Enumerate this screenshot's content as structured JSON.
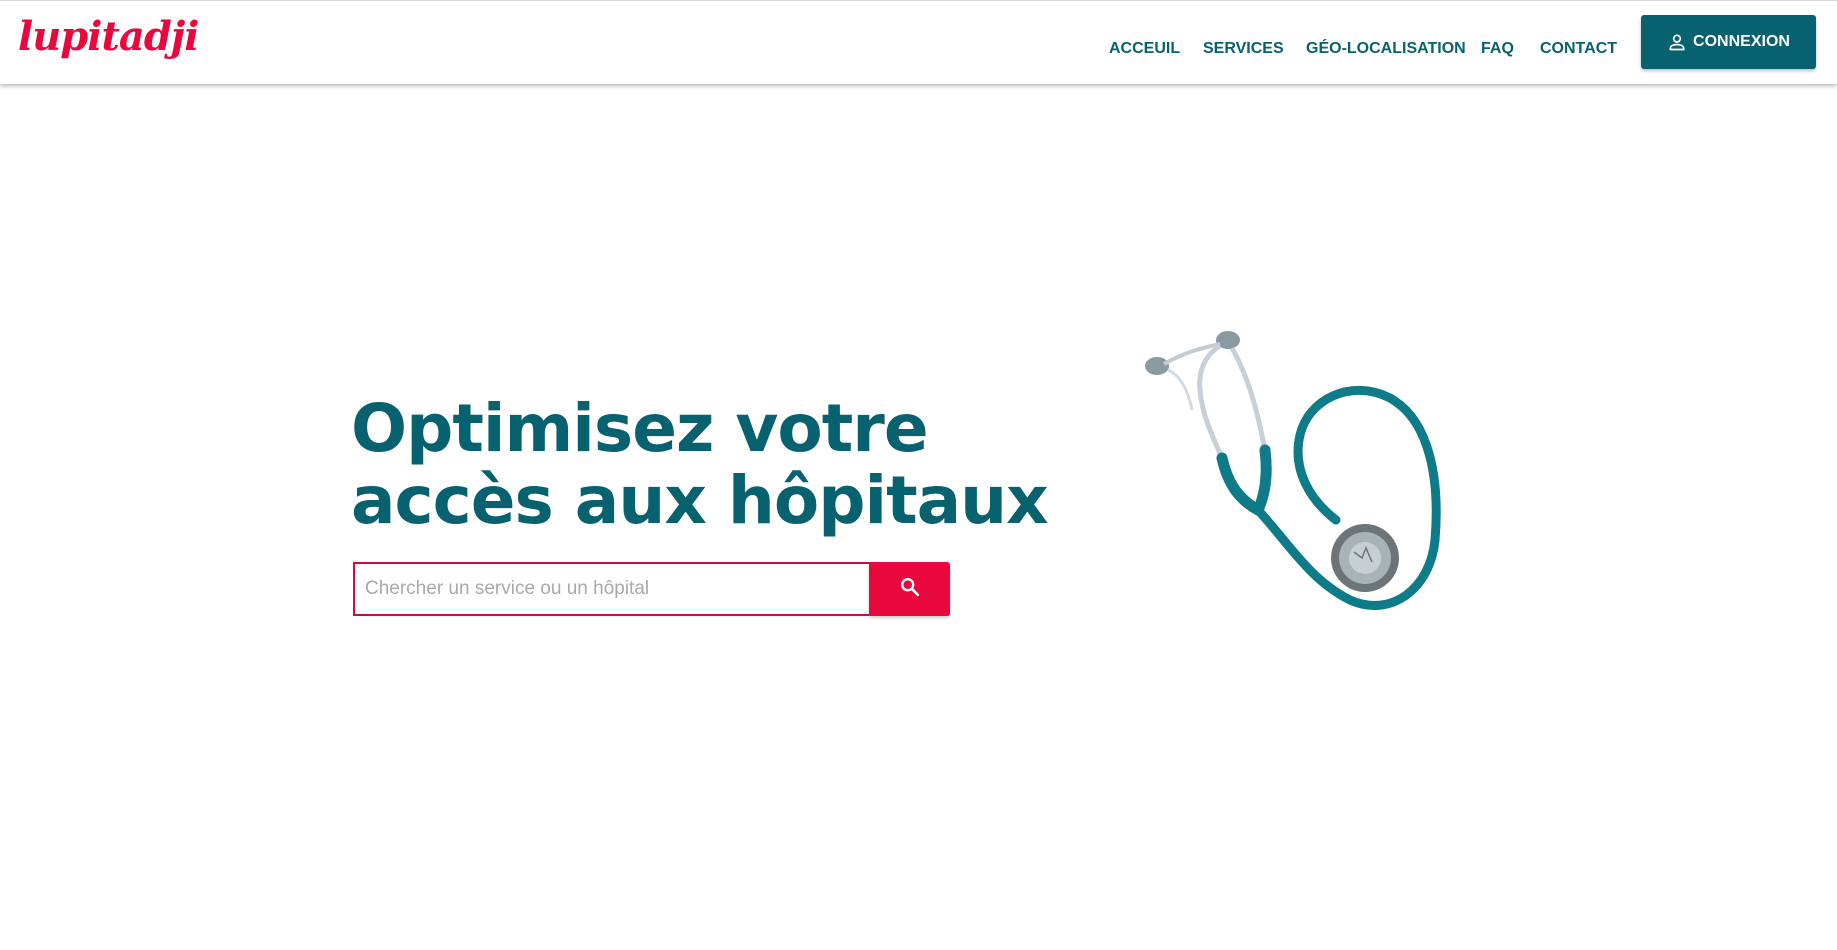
{
  "brand": {
    "logo_text": "lupitadji",
    "accent_color": "#e8083e",
    "primary_color": "#07616f"
  },
  "nav": {
    "items": [
      {
        "label": "ACCEUIL"
      },
      {
        "label": "SERVICES"
      },
      {
        "label": "GÉO-LOCALISATION"
      },
      {
        "label": "FAQ"
      },
      {
        "label": "CONTACT"
      }
    ],
    "login": {
      "label": "CONNEXION",
      "icon": "person-outline-icon"
    }
  },
  "hero": {
    "title_line1": "Optimisez votre",
    "title_line2": "accès aux hôpitaux",
    "search": {
      "placeholder": "Chercher un service ou un hôpital",
      "value": "",
      "button_icon": "search-icon"
    },
    "image": {
      "subject": "stethoscope",
      "icon": "stethoscope-illustration"
    }
  }
}
